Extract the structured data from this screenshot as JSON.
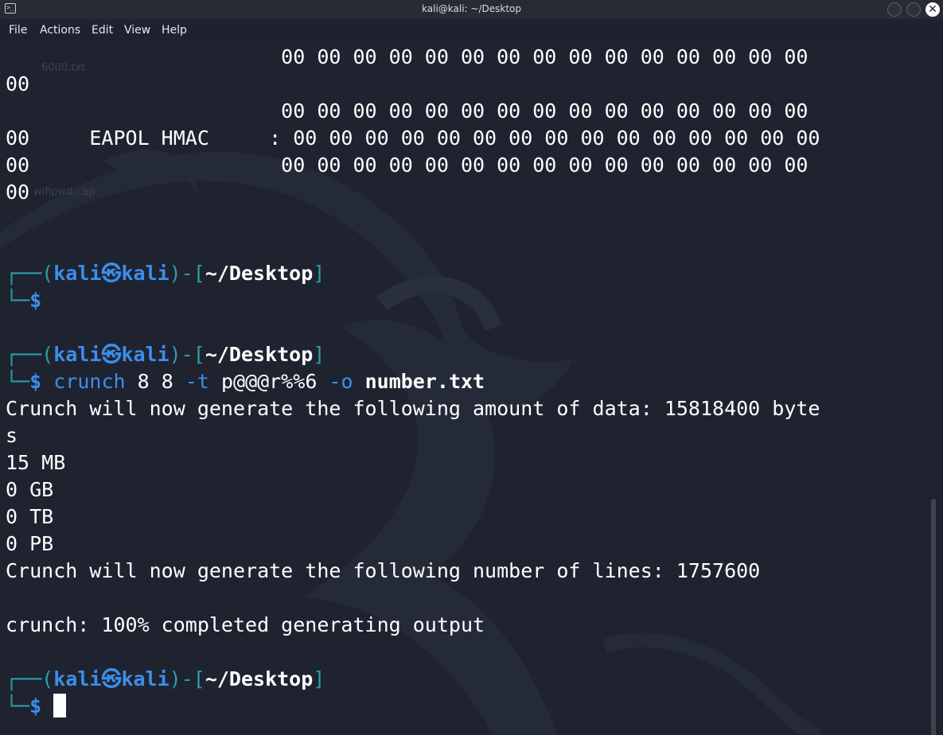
{
  "window": {
    "title": "kali@kali: ~/Desktop"
  },
  "menu": {
    "file": "File",
    "actions": "Actions",
    "edit": "Edit",
    "view": "View",
    "help": "Help"
  },
  "desktop_icons": {
    "file1": "6000.txt",
    "file2": "wifipwd.cap"
  },
  "terminal": {
    "hex_row_1": "                       00 00 00 00 00 00 00 00 00 00 00 00 00 00 00",
    "hex_row_2": "00",
    "hex_row_3": "                       00 00 00 00 00 00 00 00 00 00 00 00 00 00 00",
    "hex_row_4": "00     EAPOL HMAC     : 00 00 00 00 00 00 00 00 00 00 00 00 00 00 00",
    "hex_row_5": "00                     00 00 00 00 00 00 00 00 00 00 00 00 00 00 00",
    "hex_row_6": "00",
    "prompt_user": "kali",
    "prompt_sep": "㉿",
    "prompt_host": "kali",
    "prompt_path": "~/Desktop",
    "prompt_symbol": "$",
    "cmd_name": "crunch",
    "cmd_args1": " 8 8 ",
    "cmd_opt_t": "-t",
    "cmd_pattern": " p@@@r%%6 ",
    "cmd_opt_o": "-o",
    "cmd_file": " number.txt",
    "out_1": "Crunch will now generate the following amount of data: 15818400 byte",
    "out_2": "s",
    "out_3": "15 MB",
    "out_4": "0 GB",
    "out_5": "0 TB",
    "out_6": "0 PB",
    "out_7": "Crunch will now generate the following number of lines: 1757600",
    "out_8": "crunch: 100% completed generating output"
  }
}
